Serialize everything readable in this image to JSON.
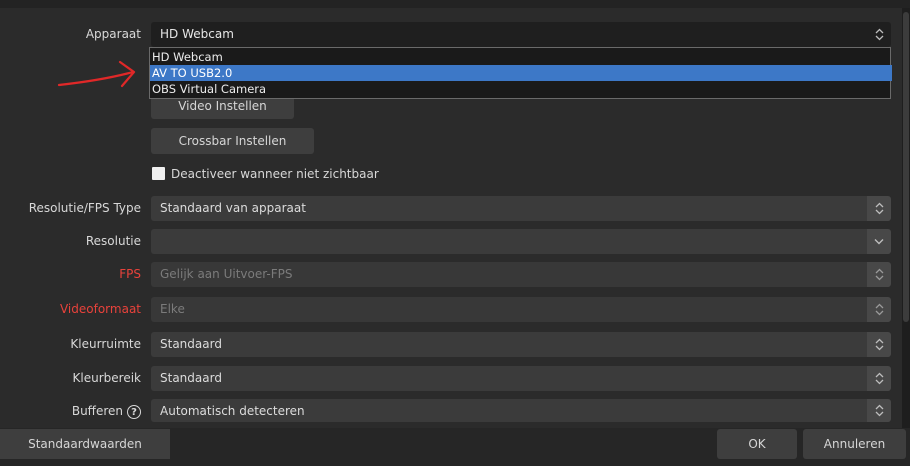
{
  "device": {
    "label": "Apparaat",
    "value": "HD Webcam",
    "options": [
      "HD Webcam",
      "AV TO USB2.0",
      "OBS Virtual Camera"
    ],
    "highlighted_option": "AV TO USB2.0"
  },
  "buttons": {
    "video_settings": "Video Instellen",
    "crossbar_settings": "Crossbar Instellen",
    "defaults": "Standaardwaarden",
    "ok": "OK",
    "cancel": "Annuleren"
  },
  "checkbox": {
    "label": "Deactiveer wanneer niet zichtbaar",
    "checked": false
  },
  "fields": {
    "res_fps_type": {
      "label": "Resolutie/FPS Type",
      "value": "Standaard van apparaat"
    },
    "resolution": {
      "label": "Resolutie",
      "value": ""
    },
    "fps": {
      "label": "FPS",
      "value": "Gelijk aan Uitvoer-FPS"
    },
    "video_format": {
      "label": "Videoformaat",
      "value": "Elke"
    },
    "color_space": {
      "label": "Kleurruimte",
      "value": "Standaard"
    },
    "color_range": {
      "label": "Kleurbereik",
      "value": "Standaard"
    },
    "buffering": {
      "label": "Bufferen",
      "value": "Automatisch detecteren"
    }
  },
  "colors": {
    "background": "#2b2b2b",
    "control": "#3b3b3b",
    "selection": "#3d78c7",
    "warning_label": "#e8423b",
    "annotation_arrow": "#e02828"
  },
  "icons": {
    "updown": "updown-arrows-icon",
    "dropdown": "chevron-down-icon",
    "help": "help-icon",
    "annotation": "red-arrow-annotation"
  }
}
